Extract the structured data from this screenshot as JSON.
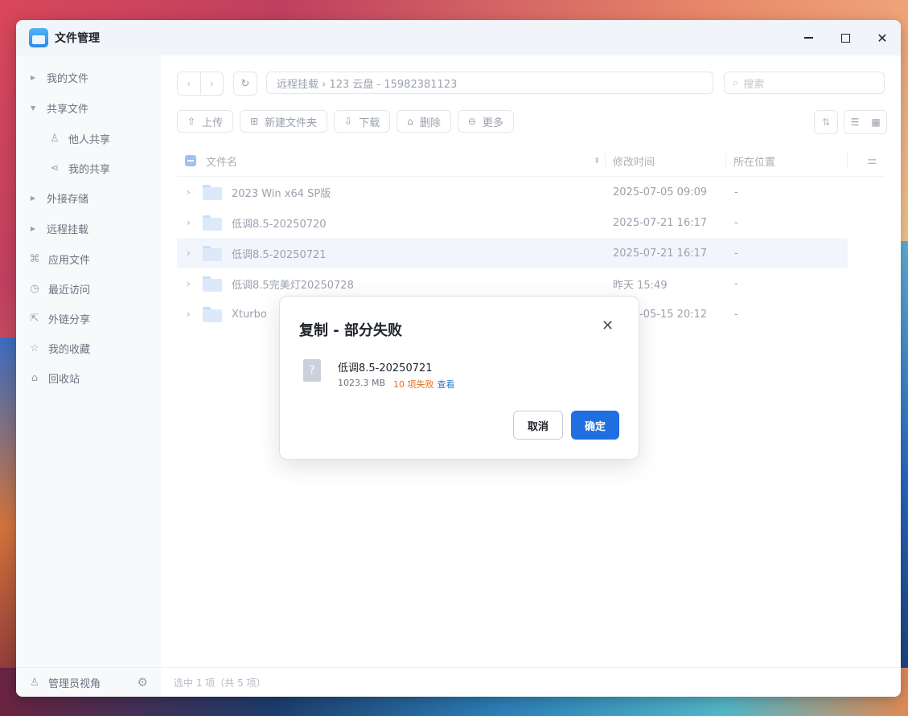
{
  "window": {
    "title": "文件管理"
  },
  "sidebar": {
    "items": [
      {
        "label": "我的文件",
        "arrow": "▶"
      },
      {
        "label": "共享文件",
        "arrow": "▼"
      },
      {
        "label": "他人共享",
        "icon": "user-icon"
      },
      {
        "label": "我的共享",
        "icon": "share-icon"
      },
      {
        "label": "外接存储",
        "arrow": "▶"
      },
      {
        "label": "远程挂载",
        "arrow": "▶"
      },
      {
        "label": "应用文件",
        "icon": "apps-icon"
      },
      {
        "label": "最近访问",
        "icon": "clock-icon"
      },
      {
        "label": "外链分享",
        "icon": "external-link-icon"
      },
      {
        "label": "我的收藏",
        "icon": "star-icon"
      },
      {
        "label": "回收站",
        "icon": "trash-icon"
      }
    ],
    "footer_label": "管理员视角"
  },
  "path": "远程挂载 › 123 云盘 - 15982381123",
  "search": {
    "placeholder": "搜索"
  },
  "toolbar": {
    "upload": "上传",
    "new_folder": "新建文件夹",
    "download": "下载",
    "delete": "删除",
    "more": "更多"
  },
  "table": {
    "columns": {
      "name": "文件名",
      "modified": "修改时间",
      "location": "所在位置"
    },
    "rows": [
      {
        "name": "2023 Win x64 SP版",
        "modified": "2025-07-05 09:09",
        "location": "-"
      },
      {
        "name": "低调8.5-20250720",
        "modified": "2025-07-21 16:17",
        "location": "-"
      },
      {
        "name": "低调8.5-20250721",
        "modified": "2025-07-21 16:17",
        "location": "-",
        "selected": true
      },
      {
        "name": "低调8.5完美灯20250728",
        "modified": "昨天 15:49",
        "location": "-"
      },
      {
        "name": "Xturbo",
        "modified": "2025-05-15 20:12",
        "location": "-"
      }
    ]
  },
  "status": "选中 1 项（共 5 项）",
  "dialog": {
    "title": "复制 - 部分失败",
    "file_name": "低调8.5-20250721",
    "size": "1023.3 MB",
    "failed": "10 项失败",
    "view_link": "查看",
    "cancel": "取消",
    "confirm": "确定"
  },
  "colors": {
    "accent": "#1f6fe0",
    "warning": "#e06b1f",
    "link": "#2b7bd9"
  }
}
